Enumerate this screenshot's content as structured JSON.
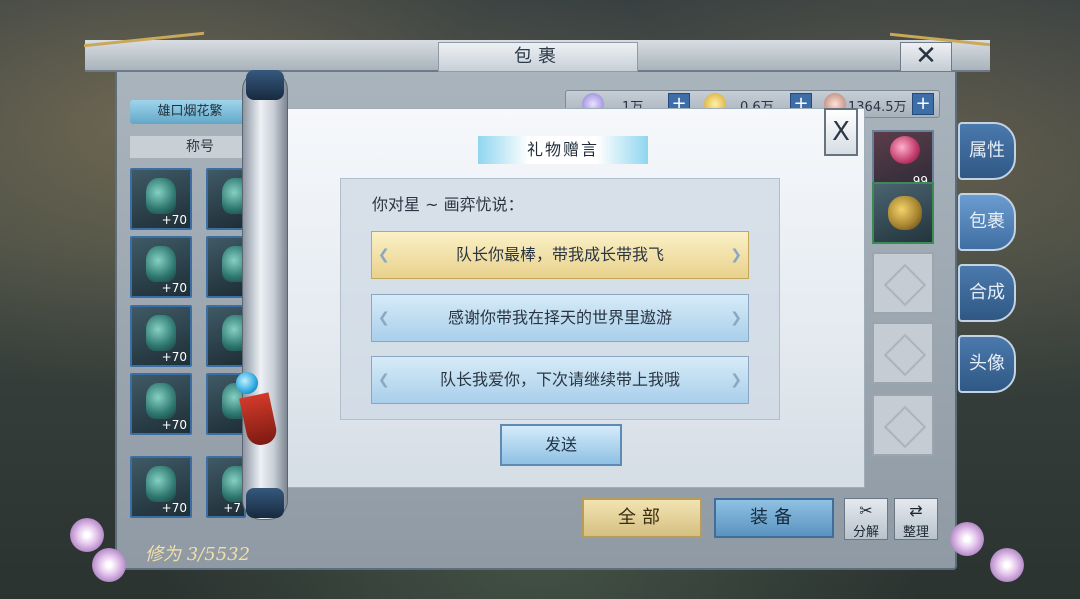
{
  "window": {
    "title": "包裹",
    "close_glyph": "✕"
  },
  "left": {
    "category_label": "雄口烟花繁",
    "title_label": "称号",
    "slots": [
      {
        "plus": "+70"
      },
      {
        "plus": ""
      },
      {
        "plus": "+70"
      },
      {
        "plus": ""
      },
      {
        "plus": "+70"
      },
      {
        "plus": ""
      },
      {
        "plus": "+70"
      },
      {
        "plus": ""
      },
      {
        "plus": "+70"
      },
      {
        "plus": "+7"
      }
    ],
    "xiuwei": "修为 3/5532"
  },
  "resources": {
    "val1": "1万",
    "val2": "0.6万",
    "val3": "1364.5万",
    "plus": "+"
  },
  "bag": {
    "gift_count": "99"
  },
  "side_tabs": [
    "属性",
    "包裹",
    "合成",
    "头像"
  ],
  "bottom": {
    "all": "全部",
    "equip": "装备",
    "decompose": "分解",
    "arrange": "整理"
  },
  "dialog": {
    "title": "礼物赠言",
    "close_glyph": "X",
    "prompt": "你对星 ~ 画弈忧说：",
    "options": [
      "队长你最棒，带我成长带我飞",
      "感谢你带我在择天的世界里遨游",
      "队长我爱你，下次请继续带上我哦"
    ],
    "selected_index": 0,
    "send": "发送"
  },
  "colors": {
    "selected_option": "#e8d18c",
    "normal_option": "#a9cfea",
    "tab_blue": "#3f6ea3"
  }
}
